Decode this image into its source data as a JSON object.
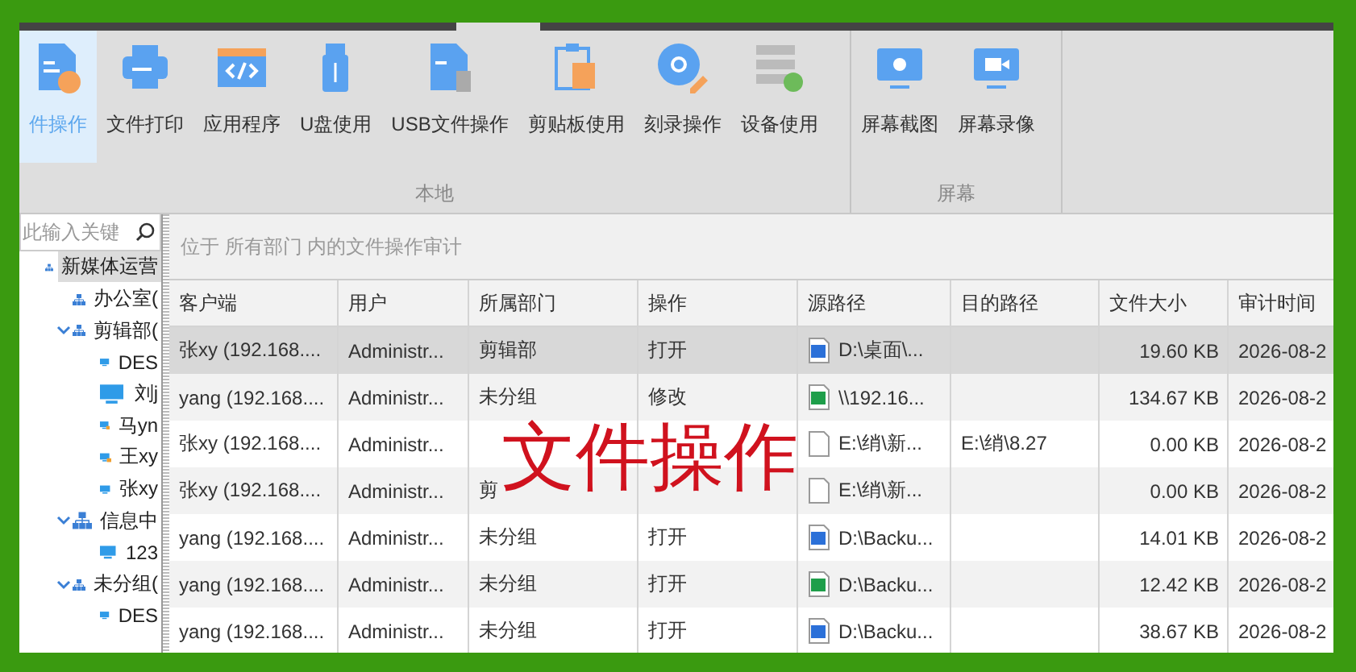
{
  "ribbon": {
    "groups": [
      {
        "label": "本地",
        "items": [
          {
            "label": "件操作",
            "kind": "file-hand",
            "selected": true
          },
          {
            "label": "文件打印",
            "kind": "printer",
            "selected": false
          },
          {
            "label": "应用程序",
            "kind": "code",
            "selected": false
          },
          {
            "label": "U盘使用",
            "kind": "usb",
            "selected": false
          },
          {
            "label": "USB文件操作",
            "kind": "usb-file",
            "selected": false
          },
          {
            "label": "剪贴板使用",
            "kind": "clipboard",
            "selected": false
          },
          {
            "label": "刻录操作",
            "kind": "disc",
            "selected": false
          },
          {
            "label": "设备使用",
            "kind": "server",
            "selected": false
          }
        ]
      },
      {
        "label": "屏幕",
        "items": [
          {
            "label": "屏幕截图",
            "kind": "camera",
            "selected": false
          },
          {
            "label": "屏幕录像",
            "kind": "video",
            "selected": false
          }
        ]
      }
    ]
  },
  "sidebar": {
    "search": {
      "placeholder": "此输入关键"
    },
    "tree": [
      {
        "label": "新媒体运营",
        "kind": "department",
        "selected": true,
        "children": [
          {
            "label": "办公室(",
            "kind": "department",
            "selected": false
          },
          {
            "label": "剪辑部(",
            "kind": "department",
            "selected": false,
            "expanded": true,
            "children": [
              {
                "label": "DES",
                "kind": "computer",
                "locked": false,
                "selected": false
              },
              {
                "label": "刘j",
                "kind": "computer",
                "locked": false,
                "selected": false
              },
              {
                "label": "马yn",
                "kind": "computer",
                "locked": true,
                "selected": false
              },
              {
                "label": "王xy",
                "kind": "computer",
                "locked": true,
                "selected": false
              },
              {
                "label": "张xy",
                "kind": "computer",
                "locked": false,
                "selected": false
              }
            ]
          },
          {
            "label": "信息中",
            "kind": "department",
            "selected": false,
            "expanded": true,
            "children": [
              {
                "label": "123",
                "kind": "computer",
                "locked": false,
                "selected": false
              }
            ]
          },
          {
            "label": "未分组(",
            "kind": "department",
            "selected": false,
            "expanded": true,
            "children": [
              {
                "label": "DES",
                "kind": "computer",
                "locked": false,
                "selected": false
              }
            ]
          }
        ]
      }
    ]
  },
  "breadcrumb": "位于 所有部门 内的文件操作审计",
  "table": {
    "columns": [
      "客户端",
      "用户",
      "所属部门",
      "操作",
      "源路径",
      "目的路径",
      "文件大小",
      "审计时间"
    ],
    "rows": [
      {
        "selected": true,
        "kind": "word",
        "cells": [
          "张xy (192.168....",
          "Administr...",
          "剪辑部",
          "打开",
          "D:\\桌面\\...",
          "",
          "19.60 KB",
          "2026-08-2"
        ]
      },
      {
        "selected": false,
        "kind": "spreadsheet",
        "cells": [
          "yang (192.168....",
          "Administr...",
          "未分组",
          "修改",
          "\\\\192.16...",
          "",
          "134.67 KB",
          "2026-08-2"
        ]
      },
      {
        "selected": false,
        "kind": "blank",
        "cells": [
          "张xy (192.168....",
          "Administr...",
          "",
          "",
          "E:\\绡\\新...",
          "E:\\绡\\8.27",
          "0.00 KB",
          "2026-08-2"
        ]
      },
      {
        "selected": false,
        "kind": "blank",
        "cells": [
          "张xy (192.168....",
          "Administr...",
          "剪",
          "",
          "E:\\绡\\新...",
          "",
          "0.00 KB",
          "2026-08-2"
        ]
      },
      {
        "selected": false,
        "kind": "word",
        "cells": [
          "yang (192.168....",
          "Administr...",
          "未分组",
          "打开",
          "D:\\Backu...",
          "",
          "14.01 KB",
          "2026-08-2"
        ]
      },
      {
        "selected": false,
        "kind": "spreadsheet",
        "cells": [
          "yang (192.168....",
          "Administr...",
          "未分组",
          "打开",
          "D:\\Backu...",
          "",
          "12.42 KB",
          "2026-08-2"
        ]
      },
      {
        "selected": false,
        "kind": "word",
        "cells": [
          "yang (192.168....",
          "Administr...",
          "未分组",
          "打开",
          "D:\\Backu...",
          "",
          "38.67 KB",
          "2026-08-2"
        ]
      }
    ]
  },
  "overlay_caption": "文件操作"
}
